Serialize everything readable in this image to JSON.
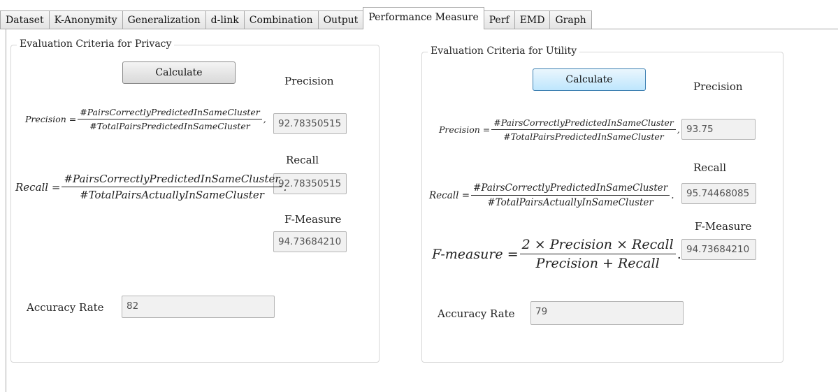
{
  "tabs": [
    "Dataset",
    "K-Anonymity",
    "Generalization",
    "d-link",
    "Combination",
    "Output",
    "Performance Measure",
    "Perf",
    "EMD",
    "Graph"
  ],
  "active_tab": "Performance Measure",
  "privacy": {
    "legend": "Evaluation Criteria for Privacy",
    "calculate_label": "Calculate",
    "precision_label": "Precision",
    "precision_value": "92.78350515",
    "recall_label": "Recall",
    "recall_value": "92.78350515",
    "fmeasure_label": "F-Measure",
    "fmeasure_value": "94.73684210",
    "accuracy_label": "Accuracy Rate",
    "accuracy_value": "82",
    "precision_formula": {
      "lhs": "Precision =",
      "num": "#PairsCorrectlyPredictedInSameCluster",
      "den": "#TotalPairsPredictedInSameCluster",
      "tail": ","
    },
    "recall_formula": {
      "lhs": "Recall =",
      "num": "#PairsCorrectlyPredictedInSameCluster",
      "den": "#TotalPairsActuallyInSameCluster",
      "tail": "."
    }
  },
  "utility": {
    "legend": "Evaluation Criteria for Utility",
    "calculate_label": "Calculate",
    "precision_label": "Precision",
    "precision_value": "93.75",
    "recall_label": "Recall",
    "recall_value": "95.74468085",
    "fmeasure_label": "F-Measure",
    "fmeasure_value": "94.73684210",
    "accuracy_label": "Accuracy Rate",
    "accuracy_value": "79",
    "precision_formula": {
      "lhs": "Precision =",
      "num": "#PairsCorrectlyPredictedInSameCluster",
      "den": "#TotalPairsPredictedInSameCluster",
      "tail": ","
    },
    "recall_formula": {
      "lhs": "Recall =",
      "num": "#PairsCorrectlyPredictedInSameCluster",
      "den": "#TotalPairsActuallyInSameCluster",
      "tail": "."
    },
    "fmeasure_formula": {
      "lhs": "F-measure =",
      "num": "2 × Precision × Recall",
      "den": "Precision + Recall",
      "tail": "."
    }
  }
}
